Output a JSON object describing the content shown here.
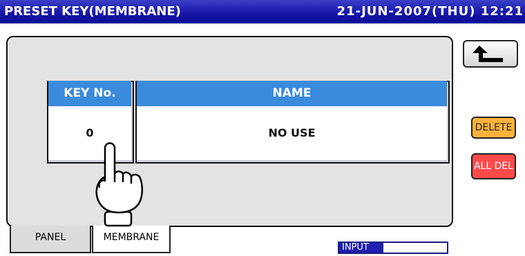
{
  "header": {
    "title": "PRESET KEY(MEMBRANE)",
    "datetime": "21-JUN-2007(THU)  12:21"
  },
  "table": {
    "columns": [
      "KEY No.",
      "NAME"
    ],
    "row": {
      "key_no": "0",
      "name": "NO USE"
    }
  },
  "buttons": {
    "back_icon": "return-arrow-icon",
    "delete": "DELETE",
    "all_del": "ALL DEL",
    "delete_color": "#ffb13b",
    "all_del_color": "#ff4a4a"
  },
  "tabs": [
    {
      "label": "PANEL",
      "selected": false
    },
    {
      "label": "MEMBRANE",
      "selected": true
    }
  ],
  "input_indicator": {
    "label": "INPUT"
  },
  "overlay": {
    "icon": "pointing-hand-icon"
  }
}
